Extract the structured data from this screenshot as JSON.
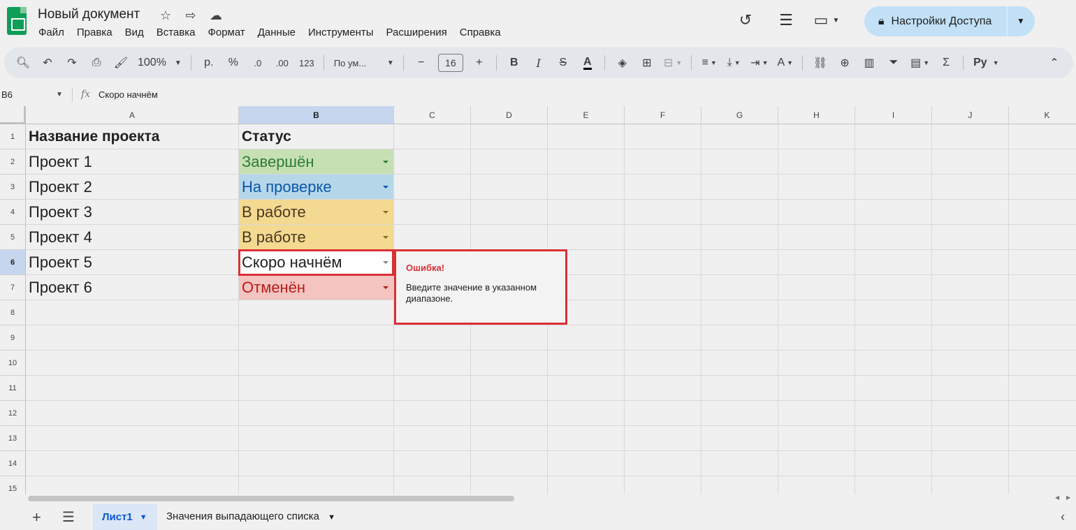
{
  "doc": {
    "title": "Новый документ",
    "title_icons": [
      "star-icon",
      "move-to-folder-icon",
      "cloud-status-icon"
    ]
  },
  "menu": [
    "Файл",
    "Правка",
    "Вид",
    "Вставка",
    "Формат",
    "Данные",
    "Инструменты",
    "Расширения",
    "Справка"
  ],
  "share": {
    "label": "Настройки Доступа"
  },
  "toolbar": {
    "zoom": "100%",
    "currency": "р.",
    "percent": "%",
    "dec_decrease": ".0",
    "dec_increase": ".00",
    "format_123": "123",
    "font": "По ум...",
    "font_size": "16",
    "input_tools": "Ру"
  },
  "formula": {
    "name_box": "B6",
    "value": "Скоро начнём"
  },
  "columns": [
    "A",
    "B",
    "C",
    "D",
    "E",
    "F",
    "G",
    "H",
    "I",
    "J",
    "K"
  ],
  "rows": [
    "1",
    "2",
    "3",
    "4",
    "5",
    "6",
    "7",
    "8",
    "9",
    "10",
    "11",
    "12",
    "13",
    "14",
    "15"
  ],
  "cells": {
    "a1": "Название проекта",
    "b1": "Статус",
    "a2": "Проект 1",
    "a3": "Проект 2",
    "a4": "Проект 3",
    "a5": "Проект 4",
    "a6": "Проект 5",
    "a7": "Проект 6",
    "b2": "Завершён",
    "b3": "На проверке",
    "b4": "В работе",
    "b5": "В работе",
    "b6": "Скоро начнём",
    "b7": "Отменён"
  },
  "status_colors": {
    "completed": {
      "bg": "#c6e0b4",
      "fg": "#2e7d32"
    },
    "review": {
      "bg": "#b6d7ea",
      "fg": "#0b57a8"
    },
    "in_progress": {
      "bg": "#f4d990",
      "fg": "#473822"
    },
    "cancelled": {
      "bg": "#f3c4c0",
      "fg": "#b71c1c"
    }
  },
  "error": {
    "title": "Ошибка!",
    "message": "Введите значение в указанном диапазоне."
  },
  "sheets": [
    "Лист1",
    "Значения выпадающего списка"
  ]
}
